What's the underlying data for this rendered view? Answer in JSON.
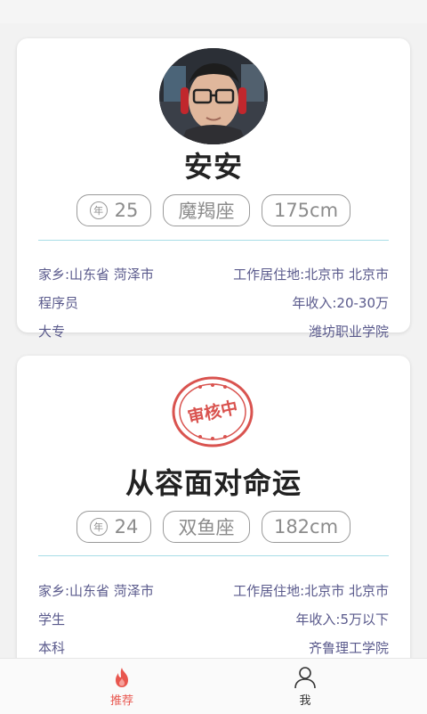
{
  "cards": [
    {
      "name": "安安",
      "age_badge": "年",
      "age": "25",
      "zodiac": "魔羯座",
      "height": "175cm",
      "hometown": "家乡:山东省 菏泽市",
      "workplace": "工作居住地:北京市 北京市",
      "occupation": "程序员",
      "income": "年收入:20-30万",
      "education": "大专",
      "school": "潍坊职业学院"
    },
    {
      "name": "从容面对命运",
      "stamp_text": "审核中",
      "age_badge": "年",
      "age": "24",
      "zodiac": "双鱼座",
      "height": "182cm",
      "hometown": "家乡:山东省 菏泽市",
      "workplace": "工作居住地:北京市 北京市",
      "occupation": "学生",
      "income": "年收入:5万以下",
      "education": "本科",
      "school": "齐鲁理工学院"
    }
  ],
  "nav": {
    "recommend": "推荐",
    "me": "我",
    "recommend_icon": "flame-icon",
    "me_icon": "person-icon",
    "active_color": "#e8564e"
  },
  "colors": {
    "divider": "#a8dde6",
    "info_text": "#5a5a8c",
    "stamp": "#d9534f"
  }
}
